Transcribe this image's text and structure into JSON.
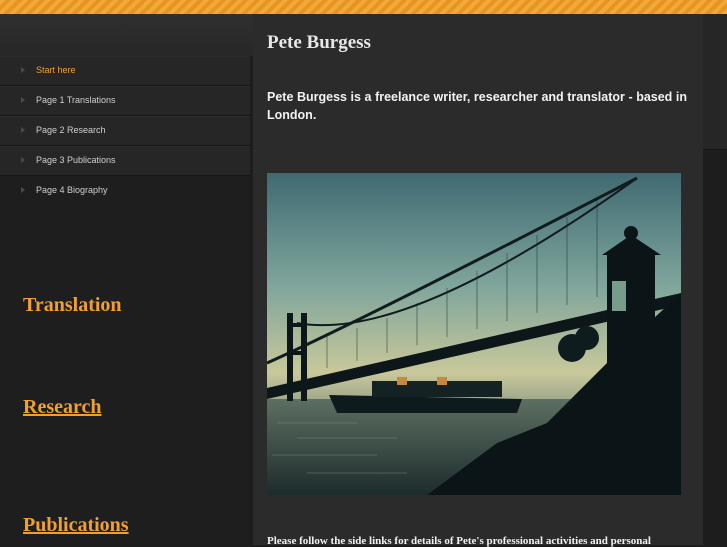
{
  "nav": {
    "items": [
      {
        "label": "Start here"
      },
      {
        "label": "Page 1 Translations"
      },
      {
        "label": "Page 2 Research"
      },
      {
        "label": "Page 3 Publications"
      },
      {
        "label": "Page 4 Biography"
      }
    ]
  },
  "sidebar": {
    "headings": {
      "translation": "Translation",
      "research": "Research",
      "publications": "Publications"
    }
  },
  "main": {
    "title": "Pete Burgess",
    "intro": "Pete Burgess is a freelance writer, researcher and translator - based in London.",
    "image_alt_icon": "bridge-photo",
    "footer": "Please follow the side links for details of Pete's professional activities and personal"
  },
  "colors": {
    "accent": "#f0a030",
    "background": "#1d1d1d",
    "panel": "#2b2b2b"
  }
}
